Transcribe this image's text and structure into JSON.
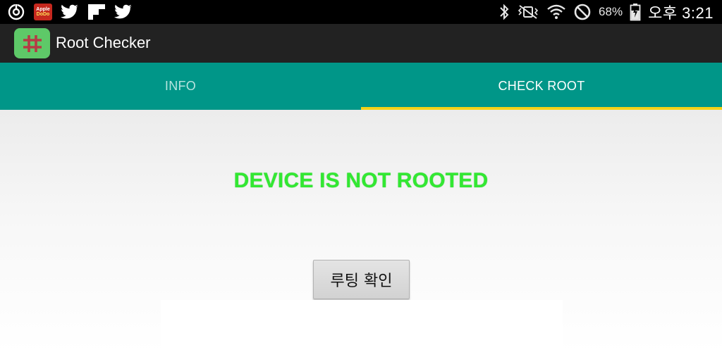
{
  "status_bar": {
    "left_icons": [
      "sync-icon",
      "apple-dodo-icon",
      "twitter-icon",
      "flipboard-icon",
      "twitter-icon"
    ],
    "apple_badge_line1": "Apple",
    "apple_badge_line2": "DoDo",
    "right_icons": [
      "bluetooth-icon",
      "vibrate-mute-icon",
      "wifi-icon",
      "do-not-disturb-icon",
      "battery-charging-icon"
    ],
    "battery_percent": "68%",
    "clock": "오후 3:21"
  },
  "action_bar": {
    "app_icon": "hash-icon",
    "title": "Root Checker"
  },
  "tabs": [
    {
      "label": "INFO",
      "selected": false
    },
    {
      "label": "CHECK ROOT",
      "selected": true
    }
  ],
  "content": {
    "result_text": "DEVICE IS NOT ROOTED",
    "check_button_label": "루팅 확인"
  },
  "colors": {
    "tab_bar": "#009688",
    "tab_indicator": "#f4d218",
    "result_text": "#32e832",
    "app_icon_bg": "#5ec968",
    "action_bar": "#222222"
  }
}
